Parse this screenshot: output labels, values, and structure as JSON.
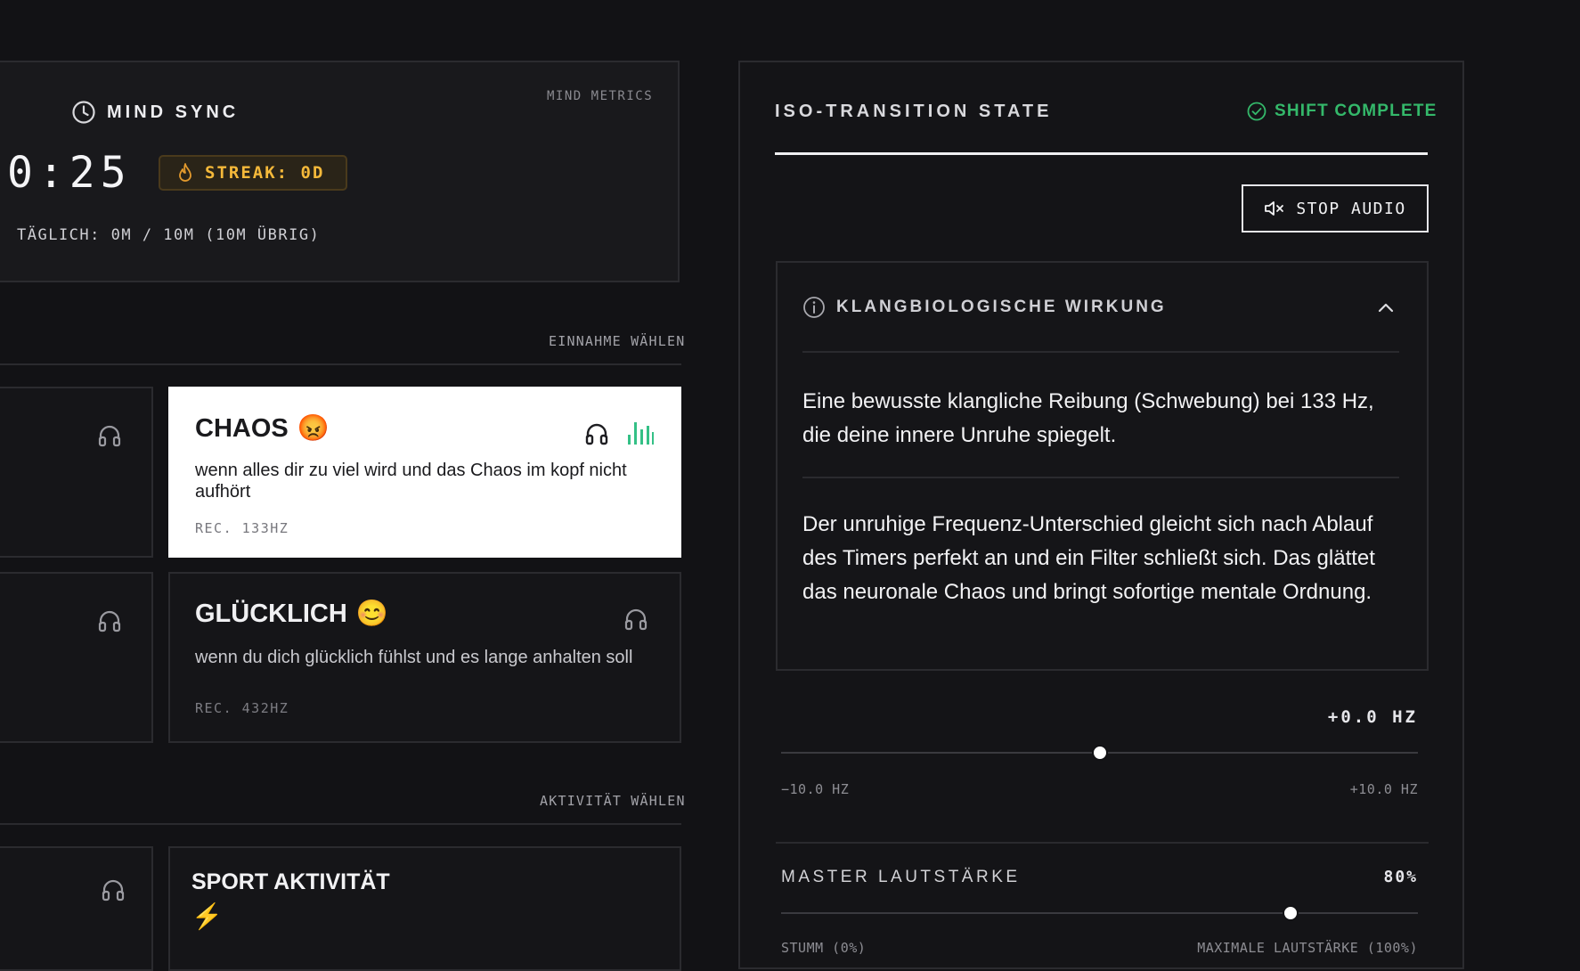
{
  "mind_sync": {
    "title": "MIND SYNC",
    "metrics_label": "MIND METRICS",
    "timer": "0:25",
    "streak": "STREAK: 0D",
    "daily": "TÄGLICH: 0M / 10M (10M ÜBRIG)"
  },
  "intake": {
    "section_label": "EINNAHME WÄHLEN",
    "moods": [
      {
        "title": "CHAOS",
        "emoji": "😡",
        "description": "wenn alles dir zu viel wird und das Chaos im kopf nicht aufhört",
        "rec": "REC. 133HZ",
        "selected": true
      },
      {
        "title": "GLÜCKLICH",
        "emoji": "😊",
        "description": "wenn du dich glücklich fühlst und es lange anhalten soll",
        "rec": "REC. 432HZ",
        "selected": false
      }
    ]
  },
  "activity": {
    "section_label": "AKTIVITÄT WÄHLEN",
    "items": [
      {
        "title": "SPORT AKTIVITÄT",
        "emoji": "⚡"
      }
    ]
  },
  "iso": {
    "title": "ISO-TRANSITION STATE",
    "status": "SHIFT COMPLETE",
    "stop_button": "STOP AUDIO",
    "info_title": "KLANGBIOLOGISCHE WIRKUNG",
    "paragraph1": "Eine bewusste klangliche Reibung (Schwebung) bei 133 Hz, die deine innere Unruhe spiegelt.",
    "paragraph2": "Der unruhige Frequenz-Unterschied gleicht sich nach Ablauf des Timers perfekt an und ein Filter schließt sich. Das glättet das neuronale Chaos und bringt sofortige mentale Ordnung.",
    "offset": {
      "value_label": "+0.0 HZ",
      "min_label": "−10.0 HZ",
      "max_label": "+10.0 HZ",
      "value": 0.0,
      "min": -10.0,
      "max": 10.0
    },
    "volume": {
      "label": "MASTER LAUTSTÄRKE",
      "value_label": "80%",
      "min_label": "STUMM (0%)",
      "max_label": "MAXIMALE LAUTSTÄRKE (100%)",
      "value": 80
    }
  },
  "colors": {
    "accent_green": "#34b86a",
    "streak_amber": "#f5b93a"
  }
}
